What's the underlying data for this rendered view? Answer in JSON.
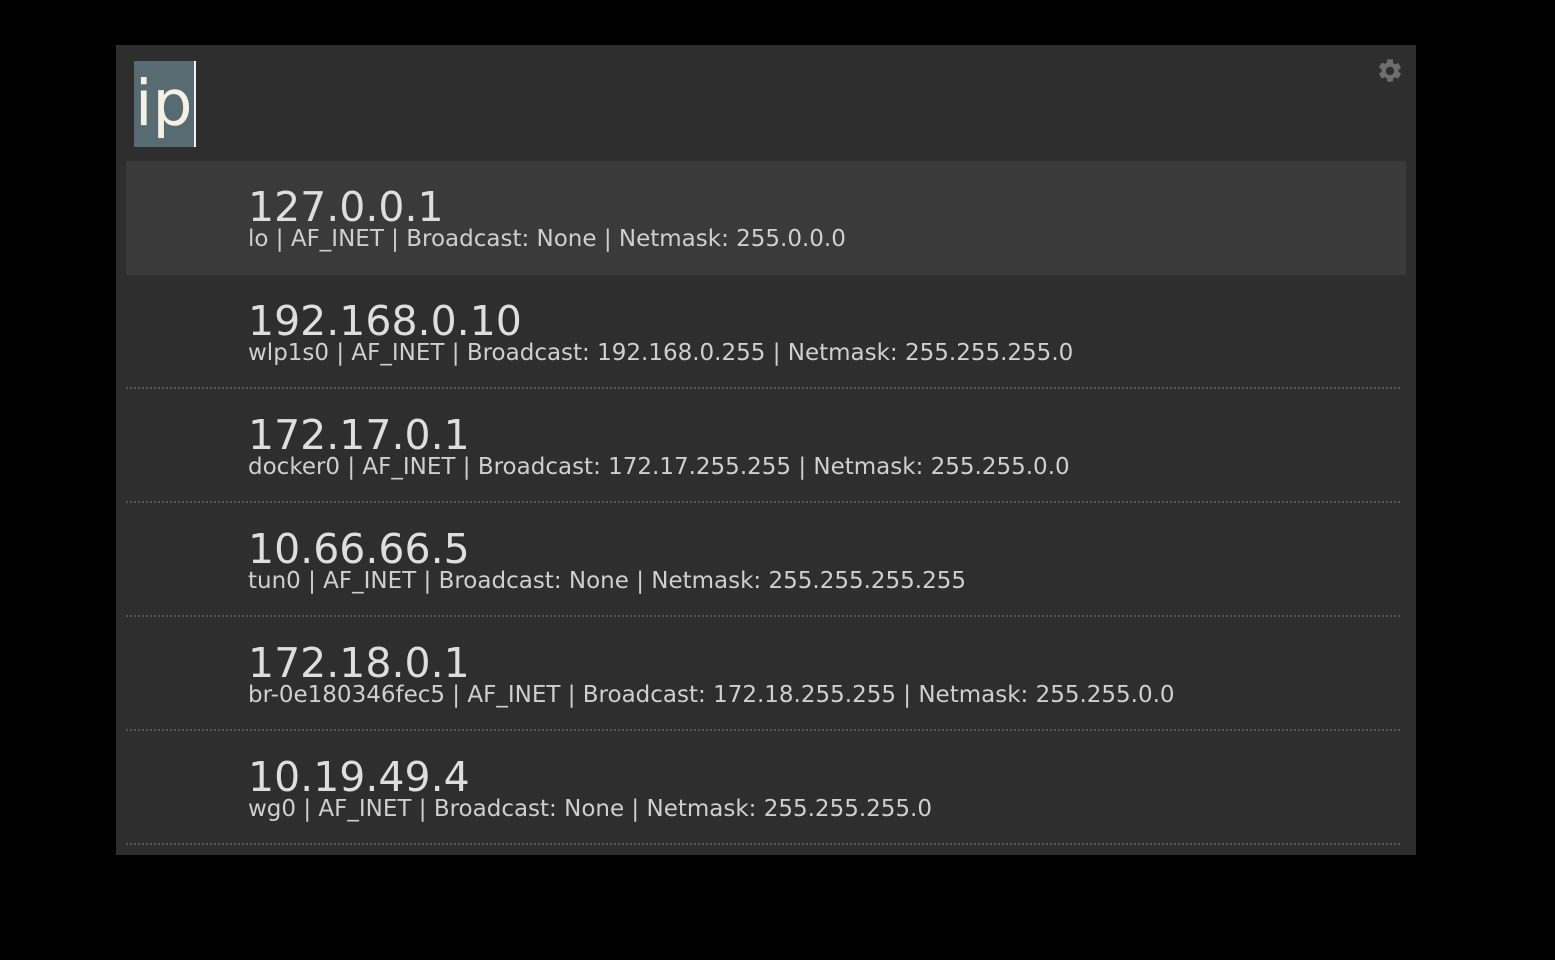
{
  "query": {
    "value": "ip"
  },
  "settings": {
    "icon": "gear-icon",
    "color": "#6e6e6e"
  },
  "results": [
    {
      "title": "127.0.0.1",
      "subtitle": "lo | AF_INET | Broadcast: None | Netmask: 255.0.0.0",
      "selected": true
    },
    {
      "title": "192.168.0.10",
      "subtitle": "wlp1s0 | AF_INET | Broadcast: 192.168.0.255 | Netmask: 255.255.255.0",
      "selected": false
    },
    {
      "title": "172.17.0.1",
      "subtitle": "docker0 | AF_INET | Broadcast: 172.17.255.255 | Netmask: 255.255.0.0",
      "selected": false
    },
    {
      "title": "10.66.66.5",
      "subtitle": "tun0 | AF_INET | Broadcast: None | Netmask: 255.255.255.255",
      "selected": false
    },
    {
      "title": "172.18.0.1",
      "subtitle": "br-0e180346fec5 | AF_INET | Broadcast: 172.18.255.255 | Netmask: 255.255.0.0",
      "selected": false
    },
    {
      "title": "10.19.49.4",
      "subtitle": "wg0 | AF_INET | Broadcast: None | Netmask: 255.255.255.0",
      "selected": false
    }
  ],
  "colors": {
    "background": "#2e2e2e",
    "selected_row": "#3a3a3a",
    "query_highlight": "#586a72",
    "text": "#dedede"
  }
}
